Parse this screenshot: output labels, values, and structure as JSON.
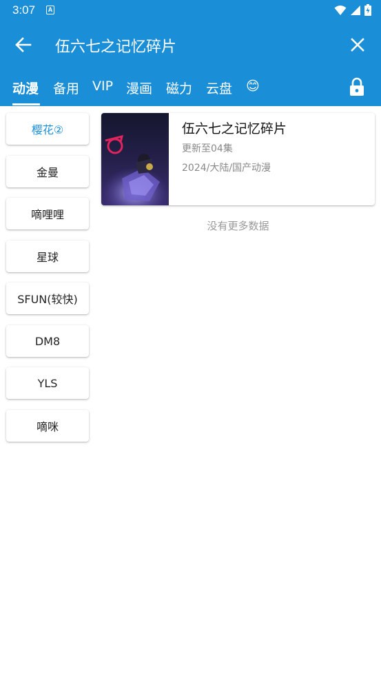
{
  "status_bar": {
    "time": "3:07",
    "notification_letter": "A"
  },
  "header": {
    "search_query": "伍六七之记忆碎片",
    "background_color": "#1a8fd8"
  },
  "tabs": [
    {
      "label": "动漫",
      "active": true
    },
    {
      "label": "备用",
      "active": false
    },
    {
      "label": "VIP",
      "active": false
    },
    {
      "label": "漫画",
      "active": false
    },
    {
      "label": "磁力",
      "active": false
    },
    {
      "label": "云盘",
      "active": false
    },
    {
      "label": "😊",
      "active": false
    }
  ],
  "sources": [
    {
      "label": "樱花②",
      "active": true
    },
    {
      "label": "金曼",
      "active": false
    },
    {
      "label": "嘀哩哩",
      "active": false
    },
    {
      "label": "星球",
      "active": false
    },
    {
      "label": "SFUN(较快)",
      "active": false
    },
    {
      "label": "DM8",
      "active": false
    },
    {
      "label": "YLS",
      "active": false
    },
    {
      "label": "嘀咪",
      "active": false
    }
  ],
  "results": [
    {
      "title": "伍六七之记忆碎片",
      "update": "更新至04集",
      "meta": "2024/大陆/国产动漫"
    }
  ],
  "footer_text": "没有更多数据",
  "colors": {
    "accent": "#1a8fd8",
    "muted_text": "#888888"
  }
}
